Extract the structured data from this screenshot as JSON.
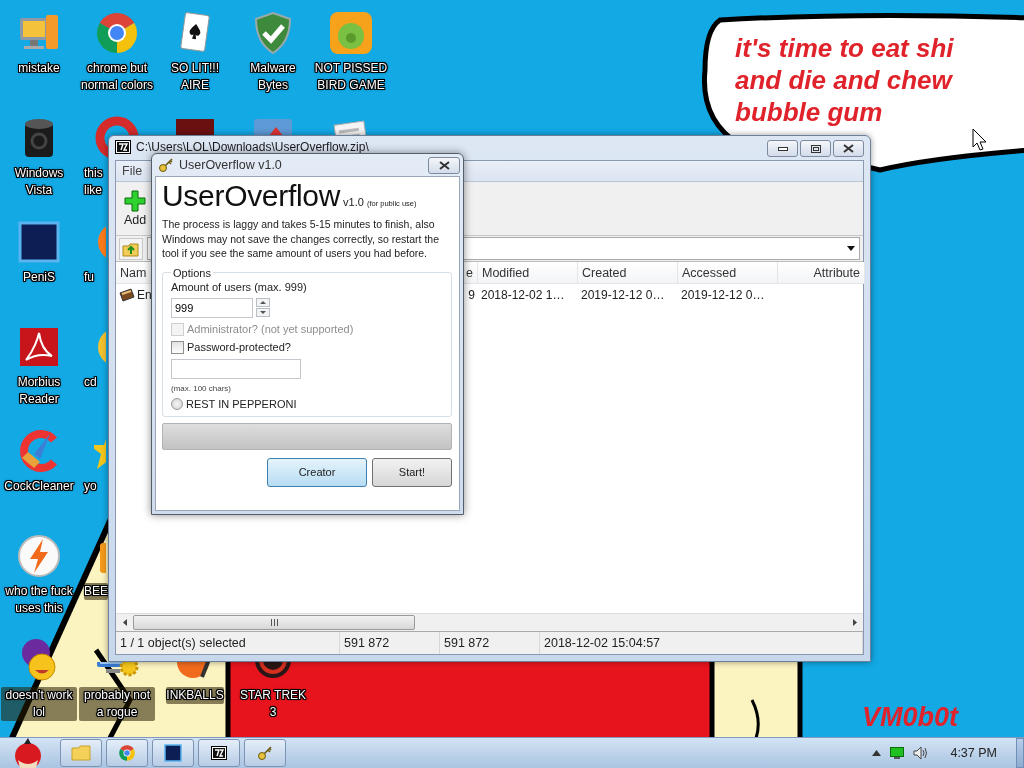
{
  "desktop": {
    "icon_columns": [
      [
        {
          "kind": "labeled",
          "label": "mistake"
        },
        {
          "kind": "labeled",
          "label": "Windows Vista"
        },
        {
          "kind": "labeled",
          "label": "PeniS"
        },
        {
          "kind": "labeled",
          "label": "Morbius Reader"
        },
        {
          "kind": "labeled",
          "label": "CockCleaner"
        },
        {
          "kind": "labeled",
          "label": "who the fuck uses this"
        },
        {
          "kind": "labeled",
          "label": "doesn't work lol"
        }
      ],
      [
        {
          "kind": "labeled",
          "label": "chrome but normal colors"
        },
        {
          "kind": "cut",
          "label": "this like"
        },
        {
          "kind": "cut",
          "label": "fu"
        },
        {
          "kind": "cut",
          "label": "cd"
        },
        {
          "kind": "cut",
          "label": "yo"
        },
        {
          "kind": "cut",
          "label": "BEE"
        },
        {
          "kind": "labeled",
          "label": "probably not a rogue"
        }
      ],
      [
        {
          "kind": "labeled",
          "label": "SO LIT!!! AIRE"
        },
        {
          "kind": "icon_only"
        },
        null,
        null,
        null,
        null,
        {
          "kind": "labeled",
          "label": "INKBALLS"
        }
      ],
      [
        {
          "kind": "labeled",
          "label": "Malware Bytes"
        },
        {
          "kind": "icon_only"
        },
        null,
        null,
        null,
        null,
        {
          "kind": "labeled",
          "label": "STAR TREK 3"
        }
      ],
      [
        {
          "kind": "labeled",
          "label": "NOT PISSED BIRD GAME"
        },
        {
          "kind": "icon_only"
        },
        null,
        null,
        null,
        null,
        null
      ]
    ],
    "speech_bubble": [
      "it's time to eat shi",
      "and die and chew",
      "bubble gum"
    ],
    "signature": "VM0b0t"
  },
  "archive_window": {
    "title": "C:\\Users\\LOL\\Downloads\\UserOverflow.zip\\",
    "menu": [
      "File"
    ],
    "toolbar": [
      "Add"
    ],
    "columns": [
      "Nam",
      "e",
      "Modified",
      "Created",
      "Accessed",
      "Attribute"
    ],
    "rows": [
      [
        "En",
        "9",
        "2018-12-02 1…",
        "2019-12-12 0…",
        "2019-12-12 0…"
      ]
    ],
    "status_bar": [
      "1 / 1 object(s) selected",
      "591 872",
      "591 872",
      "2018-12-02 15:04:57"
    ]
  },
  "dialog": {
    "title": "UserOverflow v1.0",
    "heading": "UserOverflow",
    "version": "v1.0",
    "edition": "(for public use)",
    "description": "The process is laggy and takes 5-15 minutes to finish, also Windows may not save the changes correctly, so restart the tool if you see the same amount of users you had before.",
    "options": {
      "legend": "Options",
      "amount_label": "Amount of users (max. 999)",
      "amount_value": "999",
      "checkboxes": [
        {
          "label": "Administrator? (not yet supported)",
          "checked": false,
          "disabled": true
        },
        {
          "label": "Password-protected?",
          "checked": false,
          "disabled": false
        }
      ],
      "password_hint": "(max. 100 chars)",
      "radio": {
        "label": "REST IN PEPPERONI",
        "selected": false
      }
    },
    "progress": {
      "level": 0
    },
    "buttons": [
      {
        "label": "Creator",
        "default": true
      },
      {
        "label": "Start!",
        "default": false
      }
    ]
  },
  "taskbar": {
    "clock": "4:37 PM"
  }
}
